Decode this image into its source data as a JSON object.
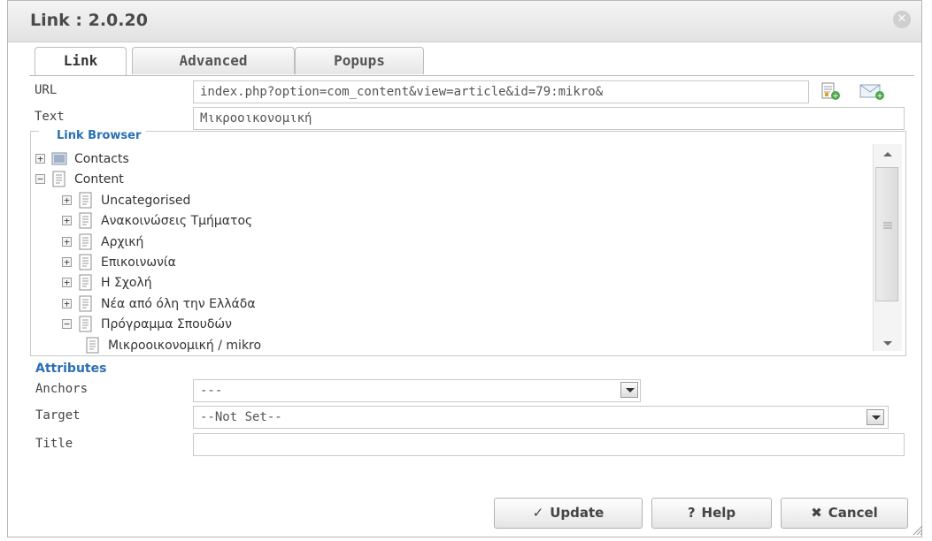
{
  "dialog": {
    "title": "Link : 2.0.20",
    "close_icon": "close-icon"
  },
  "tabs": [
    {
      "label": "Link",
      "active": true
    },
    {
      "label": "Advanced",
      "active": false
    },
    {
      "label": "Popups",
      "active": false
    }
  ],
  "fields": {
    "url_label": "URL",
    "url_value": "index.php?option=com_content&view=article&id=79:mikro&",
    "text_label": "Text",
    "text_value": "Μικροοικονομική"
  },
  "link_browser": {
    "legend": "Link Browser",
    "items": [
      {
        "label": "Contacts",
        "toggle": "+",
        "level": 0
      },
      {
        "label": "Content",
        "toggle": "−",
        "level": 0
      },
      {
        "label": "Uncategorised",
        "toggle": "+",
        "level": 1
      },
      {
        "label": "Ανακοινώσεις Τμήματος",
        "toggle": "+",
        "level": 1
      },
      {
        "label": "Αρχική",
        "toggle": "+",
        "level": 1
      },
      {
        "label": "Επικοινωνία",
        "toggle": "+",
        "level": 1
      },
      {
        "label": "Η Σχολή",
        "toggle": "+",
        "level": 1
      },
      {
        "label": "Νέα από όλη την Ελλάδα",
        "toggle": "+",
        "level": 1
      },
      {
        "label": "Πρόγραμμα Σπουδών",
        "toggle": "−",
        "level": 1
      },
      {
        "label": "Μικροοικονομική / mikro",
        "toggle": "",
        "level": 2
      }
    ]
  },
  "attributes": {
    "title": "Attributes",
    "anchors_label": "Anchors",
    "anchors_value": "---",
    "target_label": "Target",
    "target_value": "--Not Set--",
    "title_label": "Title",
    "title_value": ""
  },
  "buttons": {
    "update": "Update",
    "update_icon": "✓",
    "help": "Help",
    "help_icon": "?",
    "cancel": "Cancel",
    "cancel_icon": "✖"
  },
  "colors": {
    "accent": "#2a6fb5",
    "border": "#c9c9c9"
  }
}
